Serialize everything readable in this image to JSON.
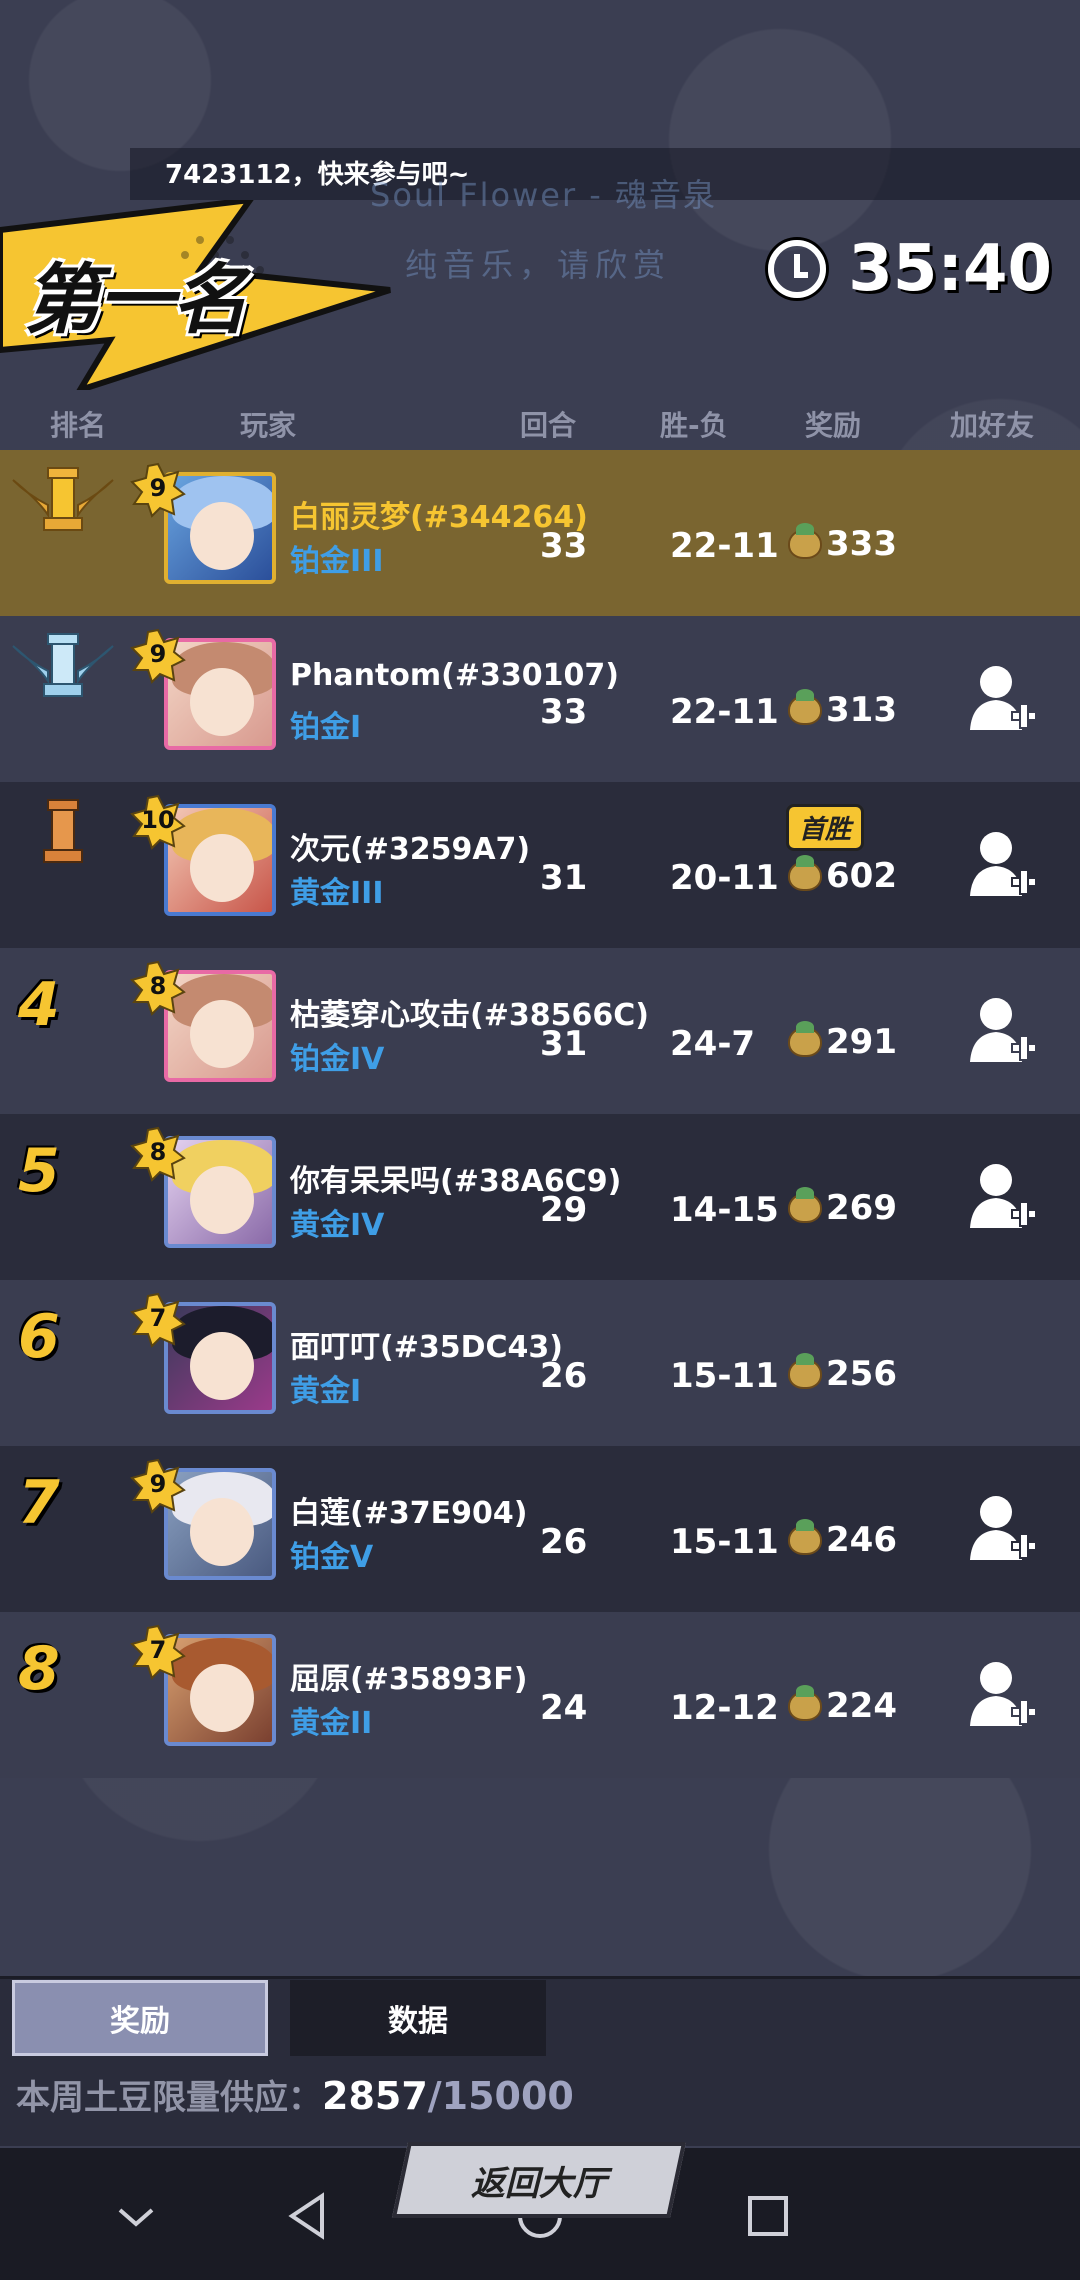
{
  "marquee": "7423112，快来参与吧~",
  "watermark": {
    "title": "Soul Flower - 魂音泉",
    "sub": "纯音乐，请欣赏"
  },
  "banner": "第一名",
  "timer": "35:40",
  "headers": {
    "rank": "排名",
    "player": "玩家",
    "rounds": "回合",
    "wl": "胜-负",
    "reward": "奖励",
    "add": "加好友"
  },
  "rows": [
    {
      "rank": "1",
      "level": "9",
      "name": "白丽灵梦(#344264)",
      "tier": "铂金III",
      "rounds": "33",
      "wl": "22-11",
      "reward": "333",
      "badge": "",
      "add_friend": false
    },
    {
      "rank": "2",
      "level": "9",
      "name": "Phantom(#330107)",
      "tier": "铂金I",
      "rounds": "33",
      "wl": "22-11",
      "reward": "313",
      "badge": "",
      "add_friend": true
    },
    {
      "rank": "3",
      "level": "10",
      "name": "次元(#3259A7)",
      "tier": "黄金III",
      "rounds": "31",
      "wl": "20-11",
      "reward": "602",
      "badge": "首胜",
      "add_friend": true
    },
    {
      "rank": "4",
      "level": "8",
      "name": "枯萎穿心攻击(#38566C)",
      "tier": "铂金IV",
      "rounds": "31",
      "wl": "24-7",
      "reward": "291",
      "badge": "",
      "add_friend": true
    },
    {
      "rank": "5",
      "level": "8",
      "name": "你有呆呆吗(#38A6C9)",
      "tier": "黄金IV",
      "rounds": "29",
      "wl": "14-15",
      "reward": "269",
      "badge": "",
      "add_friend": true
    },
    {
      "rank": "6",
      "level": "7",
      "name": "面叮叮(#35DC43)",
      "tier": "黄金I",
      "rounds": "26",
      "wl": "15-11",
      "reward": "256",
      "badge": "",
      "add_friend": false
    },
    {
      "rank": "7",
      "level": "9",
      "name": "白莲(#37E904)",
      "tier": "铂金V",
      "rounds": "26",
      "wl": "15-11",
      "reward": "246",
      "badge": "",
      "add_friend": true
    },
    {
      "rank": "8",
      "level": "7",
      "name": "屈原(#35893F)",
      "tier": "黄金II",
      "rounds": "24",
      "wl": "12-12",
      "reward": "224",
      "badge": "",
      "add_friend": true
    }
  ],
  "tabs": {
    "reward": "奖励",
    "data": "数据"
  },
  "supply": {
    "label": "本周土豆限量供应：",
    "current": "2857",
    "total": "/15000"
  },
  "return_label": "返回大厅",
  "colors": {
    "gold": "#f6c531",
    "tier_blue": "#3f9ee6",
    "highlight_row": "#7a6530"
  }
}
